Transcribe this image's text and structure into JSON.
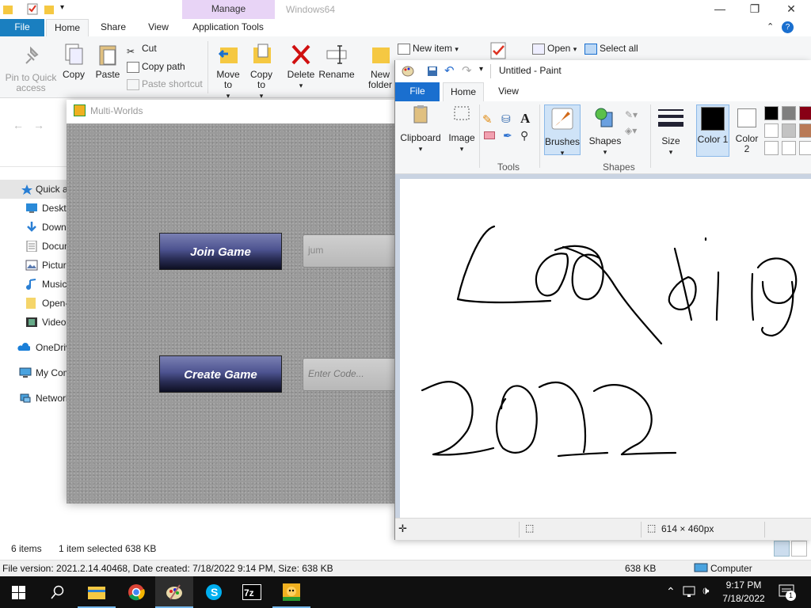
{
  "explorer": {
    "context_tab": "Manage",
    "window_title": "Windows64",
    "tabs": [
      "File",
      "Home",
      "Share",
      "View",
      "Application Tools"
    ],
    "ribbon": {
      "pin_label": "Pin to Quick access",
      "copy_label": "Copy",
      "paste_label": "Paste",
      "cut_label": "Cut",
      "copy_path_label": "Copy path",
      "paste_shortcut_label": "Paste shortcut",
      "move_to_label": "Move to",
      "copy_to_label": "Copy to",
      "delete_label": "Delete",
      "rename_label": "Rename",
      "new_folder_label": "New folder",
      "new_item_label": "New item",
      "open_label": "Open",
      "select_all_label": "Select all"
    },
    "sidebar": [
      {
        "label": "Quick access",
        "icon": "star-icon"
      },
      {
        "label": "Desktop",
        "icon": "desktop-icon"
      },
      {
        "label": "Downloads",
        "icon": "download-icon"
      },
      {
        "label": "Documents",
        "icon": "documents-icon"
      },
      {
        "label": "Pictures",
        "icon": "pictures-icon"
      },
      {
        "label": "Music",
        "icon": "music-icon"
      },
      {
        "label": "Open-",
        "icon": "folder-icon"
      },
      {
        "label": "Videos",
        "icon": "videos-icon"
      },
      {
        "label": "OneDrive",
        "icon": "cloud-icon"
      },
      {
        "label": "My Computer",
        "icon": "computer-icon"
      },
      {
        "label": "Network",
        "icon": "network-icon"
      }
    ],
    "status_items": "6 items",
    "status_selected": "1 item selected  638 KB",
    "info_file": "File version: 2021.2.14.40468, Date created: 7/18/2022 9:14 PM, Size: 638 KB",
    "info_size": "638 KB",
    "info_location": "Computer"
  },
  "multiworlds": {
    "title": "Multi-Worlds",
    "join_label": "Join Game",
    "join_input_value": "jum",
    "create_label": "Create Game",
    "code_placeholder": "Enter Code..."
  },
  "paint": {
    "title": "Untitled - Paint",
    "tabs": [
      "File",
      "Home",
      "View"
    ],
    "ribbon": {
      "clipboard": "Clipboard",
      "image": "Image",
      "tools": "Tools",
      "brushes": "Brushes",
      "shapes": "Shapes",
      "shapes_group": "Shapes",
      "size": "Size",
      "color1": "Color 1",
      "color2": "Color 2"
    },
    "palette": [
      "#000000",
      "#7f7f7f",
      "#880015",
      "#ffffff",
      "#c3c3c3",
      "#b97a57",
      "#ffffff",
      "#ffffff",
      "#ffffff"
    ],
    "canvas_size": "614 × 460px"
  },
  "taskbar": {
    "apps": [
      "start-icon",
      "search-icon",
      "file-explorer-icon",
      "chrome-icon",
      "paint-icon",
      "skype-icon",
      "7zip-icon",
      "multiworlds-icon"
    ],
    "time": "9:17 PM",
    "date": "7/18/2022",
    "notification_count": "1"
  }
}
